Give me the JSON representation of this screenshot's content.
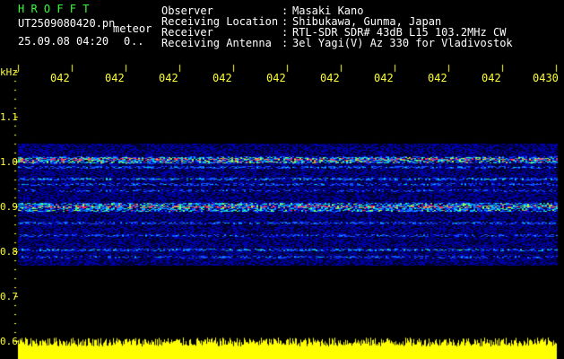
{
  "header": {
    "program": "H R O F F T",
    "filename": "UT2509080420.pn",
    "filename_suffix": "meteor",
    "datetime": "25.09.08 04:20",
    "extra_value": "0",
    "extra_dots": "..",
    "fields": [
      {
        "label": "Observer",
        "sep": ":",
        "value": "Masaki Kano"
      },
      {
        "label": "Receiving Location",
        "sep": ":",
        "value": "Shibukawa, Gunma, Japan"
      },
      {
        "label": "Receiver",
        "sep": ":",
        "value": "RTL-SDR SDR# 43dB L15 103.2MHz CW"
      },
      {
        "label": "Receiving Antenna",
        "sep": ":",
        "value": "3el Yagi(V) Az 330 for Vladivostok"
      }
    ]
  },
  "x_ticks": [
    "042",
    "042",
    "042",
    "042",
    "042",
    "042",
    "042",
    "042",
    "042",
    "0430"
  ],
  "y_unit": "kHz",
  "y_ticks": [
    "1.1",
    "1.0",
    "0.9",
    "0.8",
    "0.7",
    "0.6"
  ],
  "colors": {
    "background": "#000000",
    "header_text": "#ffffff",
    "axis_text": "#ffff33",
    "title_text": "#33ff33",
    "spectrum_bar": "#ffff00",
    "noise_low": "#0000aa",
    "noise_mid": "#00c0ff",
    "noise_high": "#ff3060"
  }
}
